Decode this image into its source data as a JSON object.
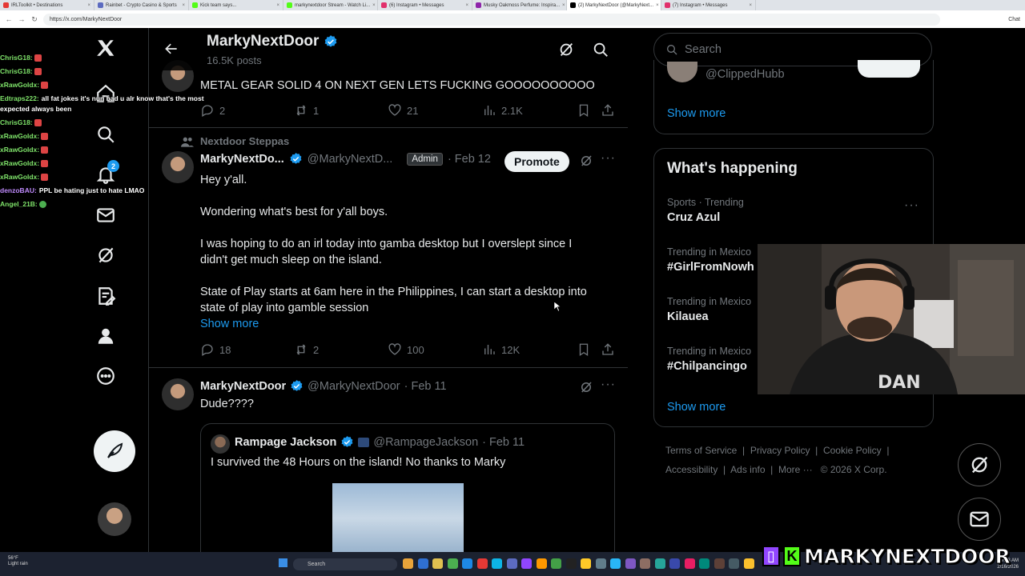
{
  "browser": {
    "tabs": [
      {
        "label": "IRLToolkit • Destinations",
        "color": "#e53935"
      },
      {
        "label": "Rainbet - Crypto Casino & Sports",
        "color": "#5c6bc0"
      },
      {
        "label": "Kick team says...",
        "color": "#53fc18"
      },
      {
        "label": "markynextdoor Stream - Watch Li...",
        "color": "#53fc18"
      },
      {
        "label": "(6) Instagram • Messages",
        "color": "#e1306c"
      },
      {
        "label": "Musky Oakmoss Perfume: Inspira...",
        "color": "#8e24aa"
      },
      {
        "label": "(2) MarkyNextDoor (@MarkyNext...",
        "color": "#000000"
      },
      {
        "label": "(7) Instagram • Messages",
        "color": "#e1306c"
      }
    ],
    "url": "https://x.com/MarkyNextDoor",
    "chat_label": "Chat"
  },
  "chat": [
    {
      "name": "ChrisG18:",
      "msg": "",
      "emote": "red"
    },
    {
      "name": "ChrisG18:",
      "msg": "",
      "emote": "red"
    },
    {
      "name": "xRawGoldx:",
      "msg": "",
      "emote": "red"
    },
    {
      "name": "Edtraps222:",
      "msg": "all fat jokes it's nun bad u alr know that's the most expected always been",
      "emote": ""
    },
    {
      "name": "ChrisG18:",
      "msg": "",
      "emote": "red"
    },
    {
      "name": "xRawGoldx:",
      "msg": "",
      "emote": "red"
    },
    {
      "name": "xRawGoldx:",
      "msg": "",
      "emote": "red"
    },
    {
      "name": "xRawGoldx:",
      "msg": "",
      "emote": "red"
    },
    {
      "name": "xRawGoldx:",
      "msg": "",
      "emote": "red"
    },
    {
      "name": "denzoBAU:",
      "msg": "PPL be hating just to hate LMAO",
      "emote": "",
      "pink": true
    },
    {
      "name": "Angel_21B:",
      "msg": "",
      "emote": "green"
    }
  ],
  "nav": {
    "notifications_badge": "2"
  },
  "header": {
    "title": "MarkyNextDoor",
    "posts": "16.5K posts"
  },
  "tweet1": {
    "text": "METAL GEAR SOLID 4 ON NEXT GEN LETS FUCKING GOOOOOOOOOO",
    "replies": "2",
    "reposts": "1",
    "likes": "21",
    "views": "2.1K"
  },
  "tweet2": {
    "community": "Nextdoor Steppas",
    "name": "MarkyNextDo...",
    "handle": "@MarkyNextD...",
    "admin": "Admin",
    "date": "Feb 12",
    "promote": "Promote",
    "lines": [
      "Hey y'all.",
      "Wondering what's best for y'all boys.",
      "I was hoping to do an irl today into gamba desktop but I overslept since I",
      "didn't get much sleep on the island.",
      "State of Play starts at 6am here in the Philippines, I can start a desktop into",
      "state of play into gamble session"
    ],
    "show_more": "Show more",
    "replies": "18",
    "reposts": "2",
    "likes": "100",
    "views": "12K"
  },
  "tweet3": {
    "name": "MarkyNextDoor",
    "handle": "@MarkyNextDoor",
    "date": "· Feb 11",
    "text": "Dude????",
    "quote": {
      "name": "Rampage Jackson",
      "handle": "@RampageJackson",
      "date": "· Feb 11",
      "text": "I survived the 48 Hours on the island! No thanks to Marky"
    }
  },
  "right": {
    "search_placeholder": "Search",
    "follow_handle": "@ClippedHubb",
    "show_more_1": "Show more",
    "whats_happening": "What's happening",
    "trends": [
      {
        "meta": "Sports · Trending",
        "name": "Cruz Azul"
      },
      {
        "meta": "Trending in Mexico",
        "name": "#GirlFromNowh"
      },
      {
        "meta": "Trending in Mexico",
        "name": "Kilauea"
      },
      {
        "meta": "Trending in Mexico",
        "name": "#Chilpancingo"
      }
    ],
    "show_more_2": "Show more",
    "footer": {
      "terms": "Terms of Service",
      "privacy": "Privacy Policy",
      "cookie": "Cookie Policy",
      "accessibility": "Accessibility",
      "ads": "Ads info",
      "more": "More ···",
      "copyright": "© 2026 X Corp."
    }
  },
  "taskbar": {
    "weather_temp": "56°F",
    "weather_desc": "Light rain",
    "search": "Search",
    "time": "9:13 AM",
    "date": "2/16/2026"
  },
  "branding": {
    "text": "MARKYNEXTDOOR",
    "twitch_color": "#9146ff",
    "kick_color": "#53fc18"
  },
  "colors": {
    "accent": "#1d9bf0",
    "background": "#000000",
    "muted": "#71767b"
  }
}
